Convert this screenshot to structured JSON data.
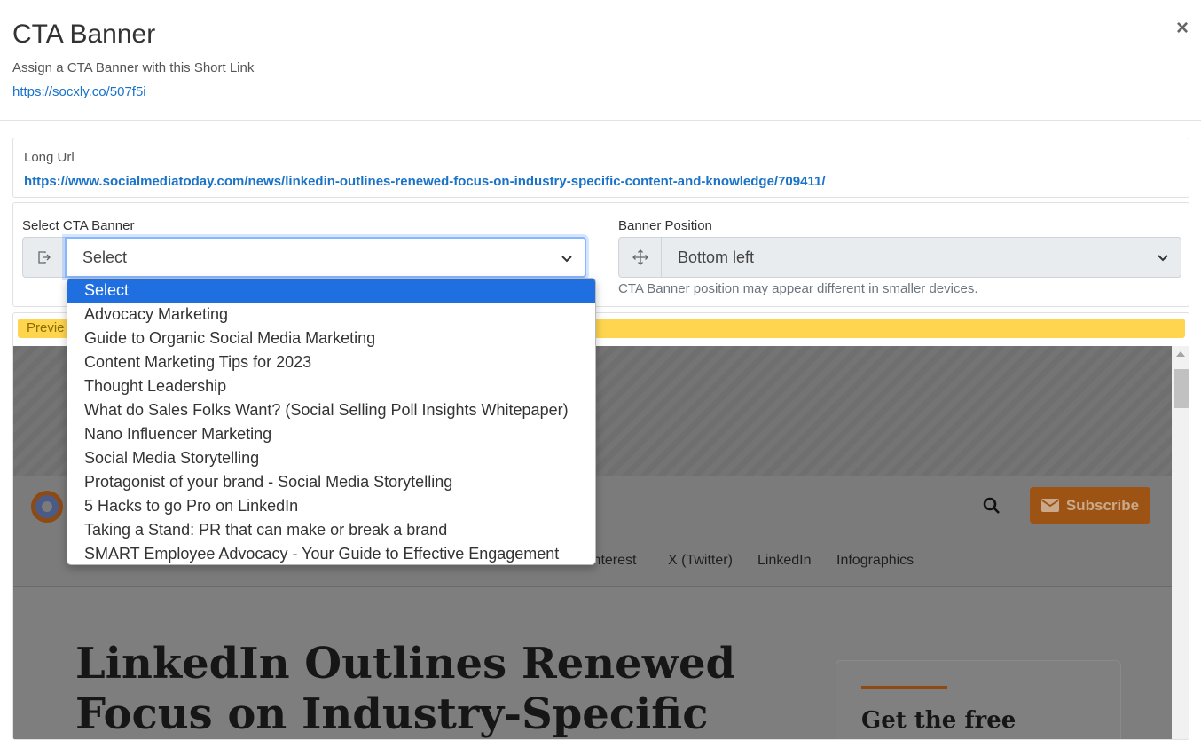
{
  "modal": {
    "title": "CTA Banner",
    "subtitle": "Assign a CTA Banner with this Short Link",
    "short_link": "https://socxly.co/507f5i",
    "close_label": "×"
  },
  "long_url": {
    "label": "Long Url",
    "value": "https://www.socialmediatoday.com/news/linkedin-outlines-renewed-focus-on-industry-specific-content-and-knowledge/709411/"
  },
  "cta_select": {
    "label": "Select CTA Banner",
    "value": "Select",
    "icon": "banner-icon",
    "options": [
      "Select",
      "Advocacy Marketing",
      "Guide to Organic Social Media Marketing",
      "Content Marketing Tips for 2023",
      "Thought Leadership",
      "What do Sales Folks Want? (Social Selling Poll Insights Whitepaper)",
      "Nano Influencer Marketing",
      "Social Media Storytelling",
      "Protagonist of your brand - Social Media Storytelling",
      "5 Hacks to go Pro on LinkedIn",
      "Taking a Stand: PR that can make or break a brand",
      "SMART Employee Advocacy - Your Guide to Effective Engagement"
    ],
    "selected_index": 0
  },
  "position_select": {
    "label": "Banner Position",
    "value": "Bottom left",
    "icon": "move-icon",
    "hint": "CTA Banner position may appear different in smaller devices."
  },
  "preview": {
    "label": "Previe",
    "site": {
      "subscribe_label": "Subscribe",
      "nav_items": [
        "interest",
        "X (Twitter)",
        "LinkedIn",
        "Infographics"
      ],
      "headline_line1": "LinkedIn Outlines Renewed",
      "headline_line2": "Focus on Industry-Specific",
      "side_title": "Get the free"
    }
  },
  "colors": {
    "link": "#1a73c8",
    "preview_bar": "#ffd54f",
    "dropdown_selected": "#1f6fe0",
    "subscribe_button": "#9c5314"
  }
}
